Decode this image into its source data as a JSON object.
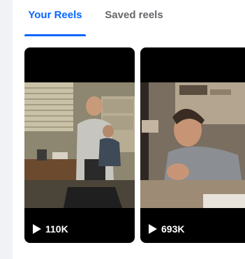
{
  "tabs": [
    {
      "label": "Your Reels",
      "active": true
    },
    {
      "label": "Saved reels",
      "active": false
    }
  ],
  "accent_color": "#0866ff",
  "reels": [
    {
      "views": "110K",
      "icon": "play-icon"
    },
    {
      "views": "693K",
      "icon": "play-icon"
    }
  ]
}
